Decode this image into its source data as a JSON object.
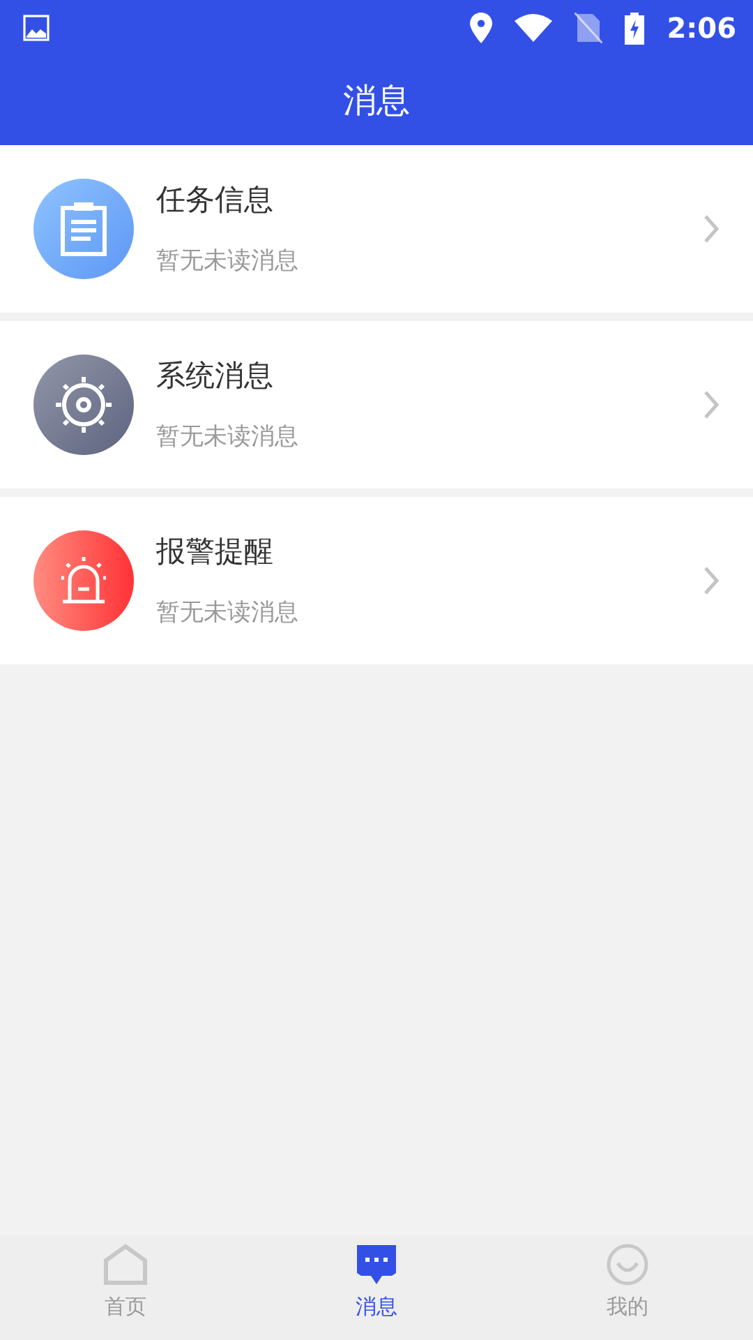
{
  "status_bar": {
    "time": "2:06"
  },
  "title": "消息",
  "messages": [
    {
      "kind": "task",
      "title": "任务信息",
      "subtitle": "暂无未读消息"
    },
    {
      "kind": "system",
      "title": "系统消息",
      "subtitle": "暂无未读消息"
    },
    {
      "kind": "alarm",
      "title": "报警提醒",
      "subtitle": "暂无未读消息"
    }
  ],
  "tabs": [
    {
      "kind": "home",
      "label": "首页",
      "selected": false
    },
    {
      "kind": "messages",
      "label": "消息",
      "selected": true
    },
    {
      "kind": "profile",
      "label": "我的",
      "selected": false
    }
  ]
}
